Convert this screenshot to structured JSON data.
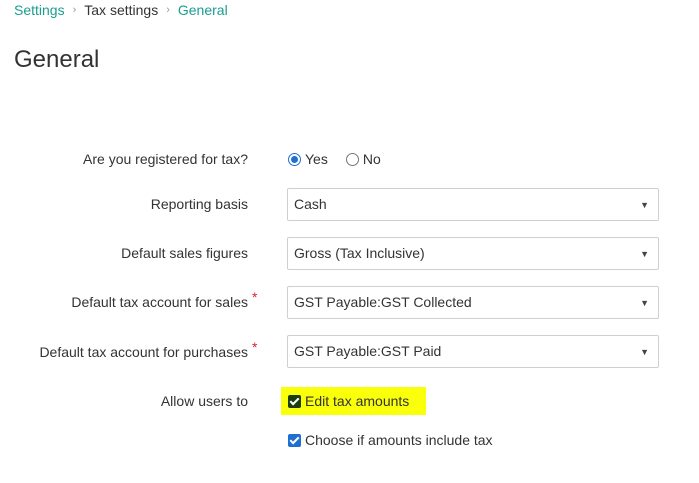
{
  "breadcrumb": {
    "items": [
      {
        "label": "Settings",
        "link": true
      },
      {
        "label": "Tax settings",
        "link": false
      },
      {
        "label": "General",
        "link": true
      }
    ],
    "separator": "›"
  },
  "page_title": "General",
  "form": {
    "registered": {
      "label": "Are you registered for tax?",
      "options": [
        {
          "label": "Yes",
          "selected": true
        },
        {
          "label": "No",
          "selected": false
        }
      ]
    },
    "reporting_basis": {
      "label": "Reporting basis",
      "value": "Cash"
    },
    "default_sales_figures": {
      "label": "Default sales figures",
      "value": "Gross (Tax Inclusive)"
    },
    "tax_account_sales": {
      "label": "Default tax account for sales",
      "required_mark": "*",
      "value": "GST Payable:GST Collected"
    },
    "tax_account_purchases": {
      "label": "Default tax account for purchases",
      "required_mark": "*",
      "value": "GST Payable:GST Paid"
    },
    "allow_users": {
      "label": "Allow users to",
      "options": [
        {
          "label": "Edit tax amounts",
          "checked": true
        },
        {
          "label": "Choose if amounts include tax",
          "checked": true
        }
      ]
    }
  },
  "icons": {
    "select_caret": "triangle-down-icon",
    "breadcrumb_sep": "chevron-right-icon"
  },
  "colors": {
    "link": "#1a9e8f",
    "required": "#d9232d",
    "highlight": "#faff0a",
    "accent": "#1f6fd1"
  }
}
